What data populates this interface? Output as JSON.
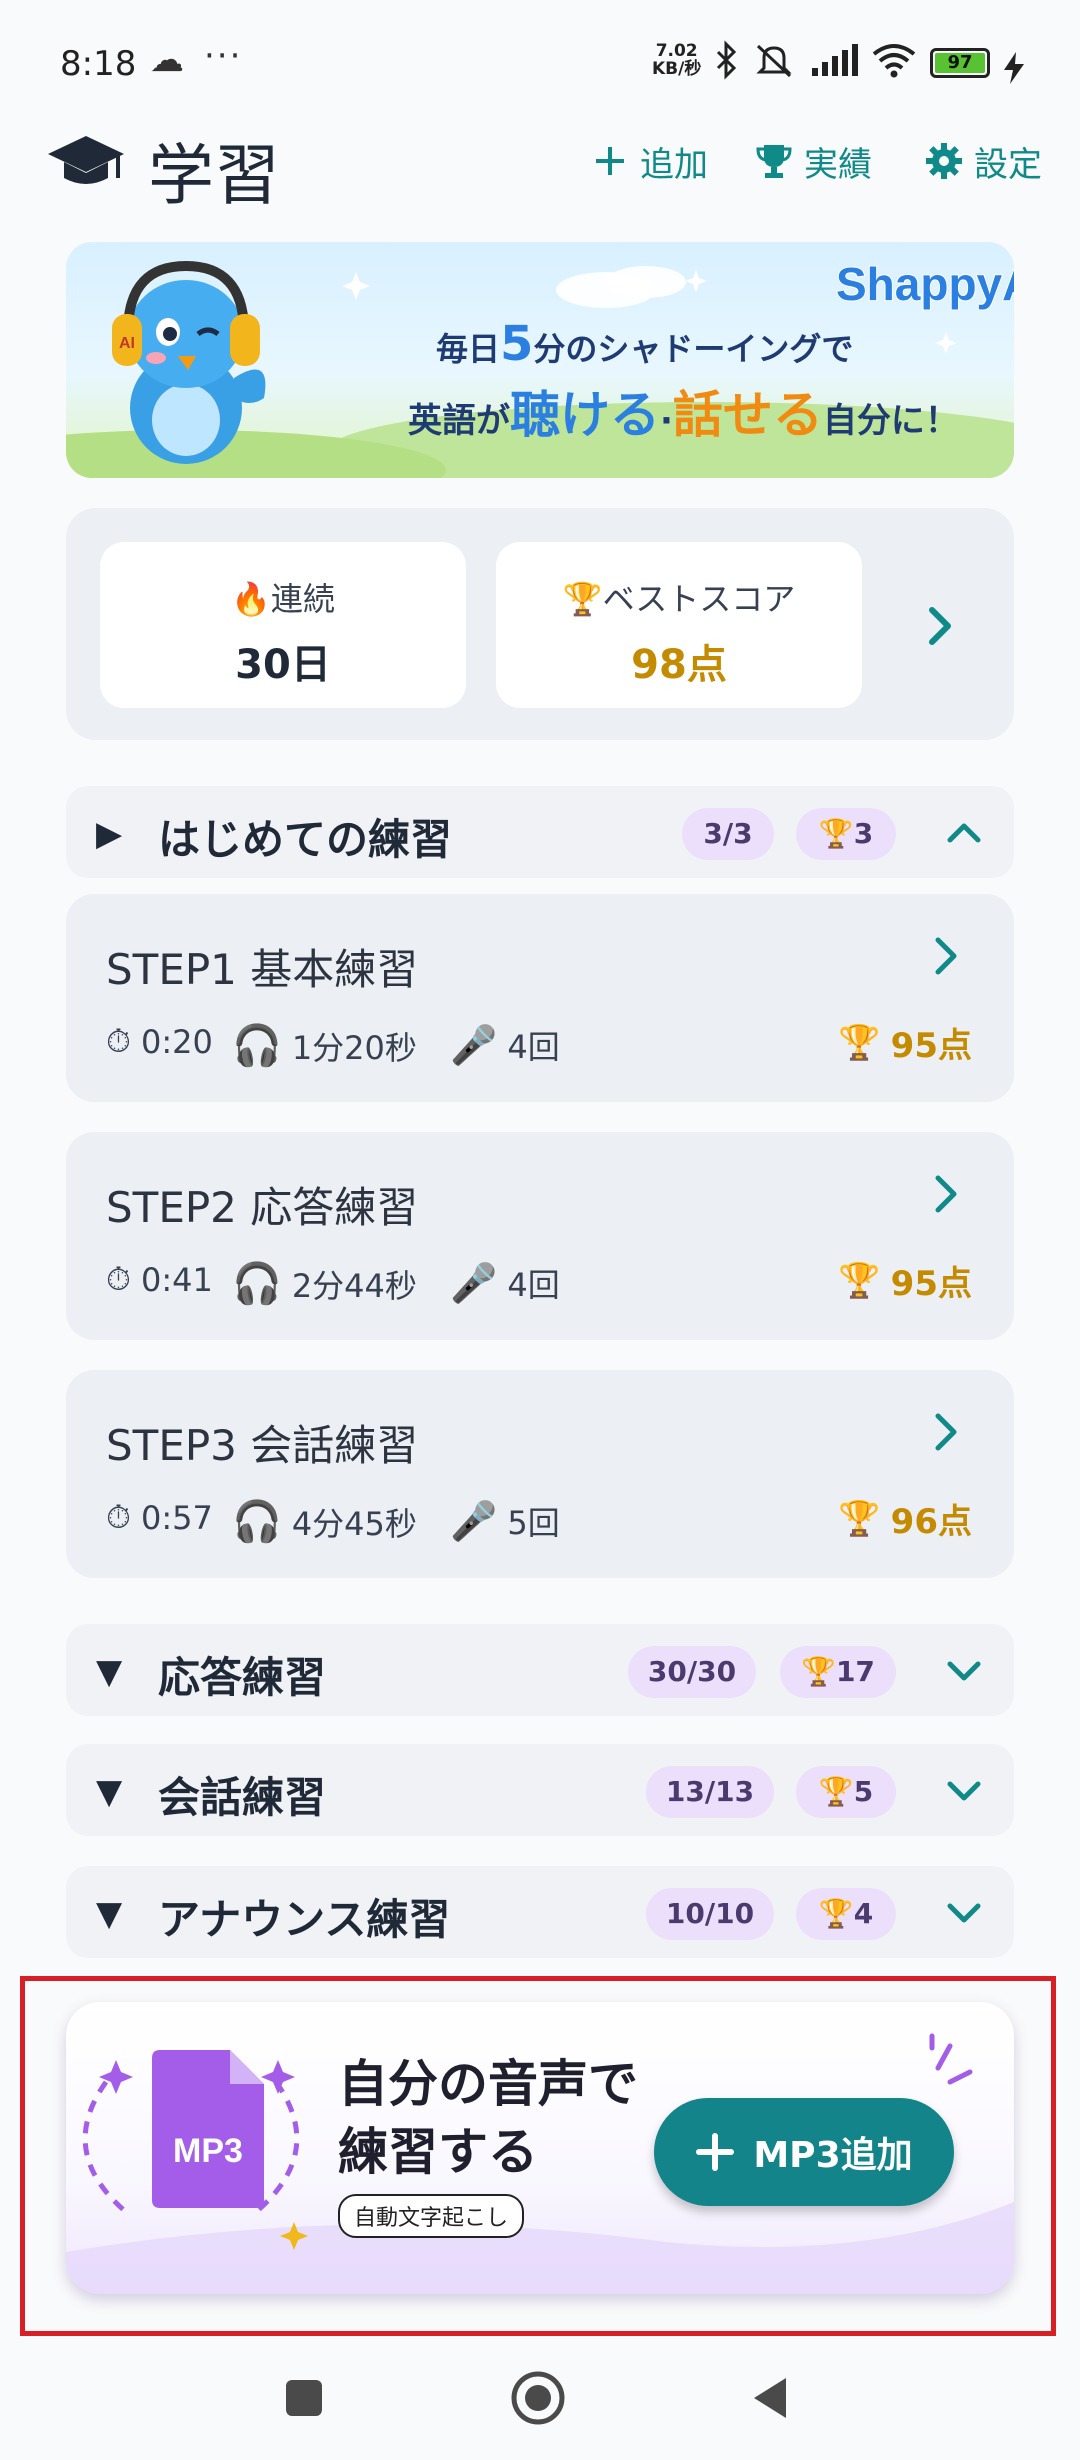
{
  "status_bar": {
    "time": "8:18",
    "speed_value": "7.02",
    "speed_unit": "KB/秒",
    "battery": "97"
  },
  "header": {
    "title": "学習",
    "add_label": "追加",
    "records_label": "実績",
    "settings_label": "設定"
  },
  "banner": {
    "brand": "ShappyAI",
    "line1_a": "毎日",
    "line1_num": "5",
    "line1_b": "分のシャドーイングで",
    "line2_a": "英語が",
    "line2_b": "聴ける",
    "line2_c": "·",
    "line2_d": "話せる",
    "line2_e": "自分に！",
    "headphone_mark": "AI"
  },
  "stats": {
    "streak_label": "連続",
    "streak_value": "30日",
    "best_label": "ベストスコア",
    "best_value": "98点"
  },
  "sections": [
    {
      "title": "はじめての練習",
      "progress": "3/3",
      "trophies": "3",
      "expanded": true
    },
    {
      "title": "応答練習",
      "progress": "30/30",
      "trophies": "17",
      "expanded": false
    },
    {
      "title": "会話練習",
      "progress": "13/13",
      "trophies": "5",
      "expanded": false
    },
    {
      "title": "アナウンス練習",
      "progress": "10/10",
      "trophies": "4",
      "expanded": false
    }
  ],
  "steps": [
    {
      "title": "STEP1 基本練習",
      "time": "0:20",
      "listen": "1分20秒",
      "count": "4回",
      "score": "95点"
    },
    {
      "title": "STEP2 応答練習",
      "time": "0:41",
      "listen": "2分44秒",
      "count": "4回",
      "score": "95点"
    },
    {
      "title": "STEP3 会話練習",
      "time": "0:57",
      "listen": "4分45秒",
      "count": "5回",
      "score": "96点"
    }
  ],
  "mp3_card": {
    "icon_label": "MP3",
    "title_line1": "自分の音声で",
    "title_line2": "練習する",
    "subtitle": "自動文字起こし",
    "button_label": "MP3追加"
  },
  "colors": {
    "accent": "#0f8a88",
    "gold": "#c48a00",
    "pill": "#ebdffb",
    "mp3_purple": "#a35de8",
    "highlight": "#d81f26"
  }
}
